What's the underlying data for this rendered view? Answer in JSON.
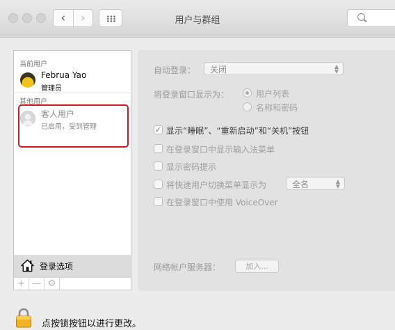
{
  "window": {
    "title": "用户与群组",
    "nav_back_glyph": "‹",
    "nav_forward_glyph": "›"
  },
  "sidebar": {
    "current_user_header": "当前用户",
    "current_user": {
      "name": "Februa Yao",
      "role": "管理员",
      "icon": "user-avatar-icon"
    },
    "other_users_header": "其他用户",
    "guest_user": {
      "name": "客人用户",
      "status": "已启用，受到管理",
      "icon": "guest-avatar-icon"
    },
    "login_options_label": "登录选项",
    "footer_buttons": [
      "+",
      "—",
      "⚙"
    ]
  },
  "settings": {
    "auto_login": {
      "label": "自动登录：",
      "value": "关闭"
    },
    "display_login_as": {
      "label": "将登录窗口显示为：",
      "options": [
        {
          "label": "用户列表",
          "selected": true
        },
        {
          "label": "名称和密码",
          "selected": false
        }
      ]
    },
    "checkboxes": [
      {
        "label": "显示“睡眠”、“重新启动”和“关机”按钮",
        "checked": true
      },
      {
        "label": "在登录窗口中显示输入法菜单",
        "checked": false
      },
      {
        "label": "显示密码提示",
        "checked": false
      },
      {
        "label": "将快速用户切换菜单显示为",
        "checked": false
      },
      {
        "label": "在登录窗口中使用 VoiceOver",
        "checked": false
      }
    ],
    "fast_switch_select": "全名",
    "network_server": {
      "label": "网络帐户服务器：",
      "button": "加入..."
    }
  },
  "footer": {
    "lock_message": "点按锁按钮以进行更改。",
    "lock_icon": "padlock-icon"
  },
  "colors": {
    "highlight_border": "#d51924",
    "lock_gold": "#f0b422"
  }
}
